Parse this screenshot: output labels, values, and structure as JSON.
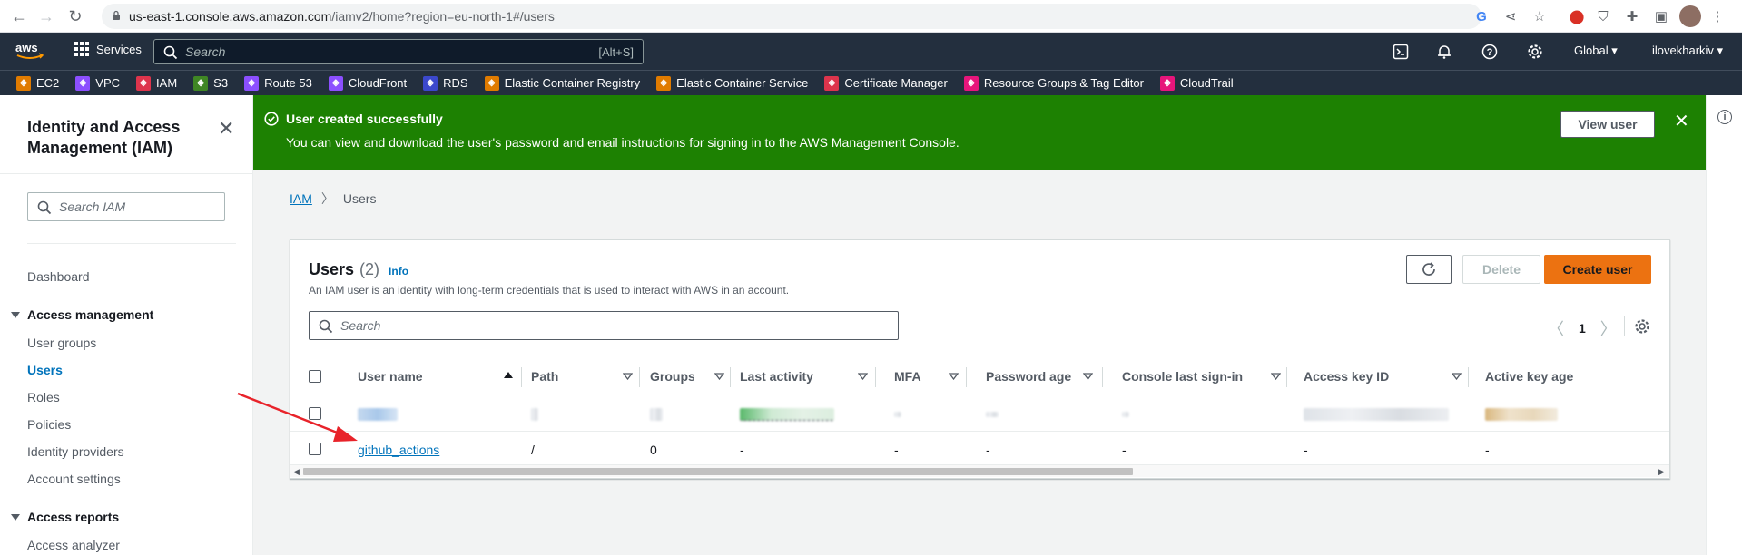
{
  "browser": {
    "url_host": "us-east-1.console.aws.amazon.com",
    "url_path": "/iamv2/home?region=eu-north-1#/users"
  },
  "topnav": {
    "services_label": "Services",
    "search_placeholder": "Search",
    "search_shortcut": "[Alt+S]",
    "region_label": "Global",
    "account_label": "ilovekharkiv"
  },
  "favorites": [
    {
      "label": "EC2",
      "color": "#e07b00"
    },
    {
      "label": "VPC",
      "color": "#8c4fff"
    },
    {
      "label": "IAM",
      "color": "#dd344c"
    },
    {
      "label": "S3",
      "color": "#3f8624"
    },
    {
      "label": "Route 53",
      "color": "#8c4fff"
    },
    {
      "label": "CloudFront",
      "color": "#8c4fff"
    },
    {
      "label": "RDS",
      "color": "#3b48cc"
    },
    {
      "label": "Elastic Container Registry",
      "color": "#e07b00"
    },
    {
      "label": "Elastic Container Service",
      "color": "#e07b00"
    },
    {
      "label": "Certificate Manager",
      "color": "#dd344c"
    },
    {
      "label": "Resource Groups & Tag Editor",
      "color": "#e7157b"
    },
    {
      "label": "CloudTrail",
      "color": "#e7157b"
    }
  ],
  "sidebar": {
    "title": "Identity and Access Management (IAM)",
    "search_placeholder": "Search IAM",
    "dashboard": "Dashboard",
    "access_management": "Access management",
    "user_groups": "User groups",
    "users": "Users",
    "roles": "Roles",
    "policies": "Policies",
    "identity_providers": "Identity providers",
    "account_settings": "Account settings",
    "access_reports": "Access reports",
    "access_analyzer": "Access analyzer"
  },
  "flash": {
    "title": "User created successfully",
    "message": "You can view and download the user's password and email instructions for signing in to the AWS Management Console.",
    "view_button": "View user",
    "color": "#1d8102"
  },
  "breadcrumb": {
    "root": "IAM",
    "current": "Users"
  },
  "users_panel": {
    "title": "Users",
    "count": "(2)",
    "info": "Info",
    "description": "An IAM user is an identity with long-term credentials that is used to interact with AWS in an account.",
    "delete_button": "Delete",
    "create_button": "Create user",
    "search_placeholder": "Search",
    "page_number": "1"
  },
  "table": {
    "columns": [
      "User name",
      "Path",
      "Groups",
      "Last activity",
      "MFA",
      "Password age",
      "Console last sign-in",
      "Access key ID",
      "Active key age"
    ],
    "rows": [
      {
        "user_name": "",
        "path": "",
        "groups": "",
        "last_activity": "",
        "mfa": "",
        "password_age": "",
        "console_last_sign_in": "",
        "access_key_id": "",
        "active_key_age": "",
        "redacted": true
      },
      {
        "user_name": "github_actions",
        "path": "/",
        "groups": "0",
        "last_activity": "-",
        "mfa": "-",
        "password_age": "-",
        "console_last_sign_in": "-",
        "access_key_id": "-",
        "active_key_age": "-",
        "redacted": false
      }
    ]
  },
  "colors": {
    "aws_nav": "#232f3e",
    "link": "#0073bb",
    "primary_button": "#ec7211",
    "annotation_arrow": "#e8232a"
  }
}
